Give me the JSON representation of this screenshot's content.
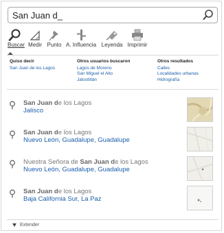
{
  "search": {
    "value": "San Juan d_"
  },
  "toolbar": {
    "buscar": "Buscar",
    "medir": "Medir",
    "punto": "Punto",
    "influencia": "A. Influencia",
    "leyenda": "Leyenda",
    "imprimir": "Imprimir"
  },
  "suggestions": {
    "quiso_decir": {
      "heading": "Quiso decir",
      "links": [
        "San Juan de los Lagos"
      ]
    },
    "otros_usuarios": {
      "heading": "Otros usuarios buscaron",
      "links": [
        "Lagos de Moreno",
        "San Miguel el Alto",
        "Jalostitlán"
      ]
    },
    "otros_resultados": {
      "heading": "Otros resultados",
      "links": [
        "Calles",
        "Localidades urbanas",
        "Hidrografía"
      ]
    }
  },
  "results": [
    {
      "pre": "",
      "bold": "San Juan d",
      "post": "e los Lagos",
      "location": "Jalisco"
    },
    {
      "pre": "",
      "bold": "San Juan d",
      "post": "e los Lagos",
      "location": "Nuevo León, Guadalupe, Guadalupe"
    },
    {
      "pre": "Nuestra Señora de ",
      "bold": "San Juan d",
      "post": "e los Lagos",
      "location": "Nuevo León, Guadalupe, Guadalupe"
    },
    {
      "pre": "",
      "bold": "San Juan d",
      "post": "e los Lagos",
      "location": "Baja California Sur, La Paz"
    }
  ],
  "footer": {
    "extend": "Extender"
  },
  "colors": {
    "link": "#1c5fad",
    "border": "#d6d6d6"
  }
}
